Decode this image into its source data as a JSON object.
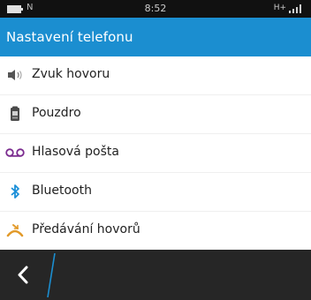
{
  "status_bar": {
    "notification": "N",
    "time": "8:52",
    "network": "H+",
    "icons": [
      "battery-icon",
      "notification-icon",
      "signal-icon"
    ]
  },
  "header": {
    "title": "Nastavení telefonu",
    "color": "#1b8ed0"
  },
  "settings_list": {
    "items": [
      {
        "label": "Zvuk hovoru",
        "icon": "speaker-icon"
      },
      {
        "label": "Pouzdro",
        "icon": "holster-icon"
      },
      {
        "label": "Hlasová pošta",
        "icon": "voicemail-icon"
      },
      {
        "label": "Bluetooth",
        "icon": "bluetooth-icon"
      },
      {
        "label": "Předávání hovorů",
        "icon": "call-forwarding-icon"
      }
    ]
  },
  "bottom_bar": {
    "back_icon": "chevron-left-icon"
  }
}
